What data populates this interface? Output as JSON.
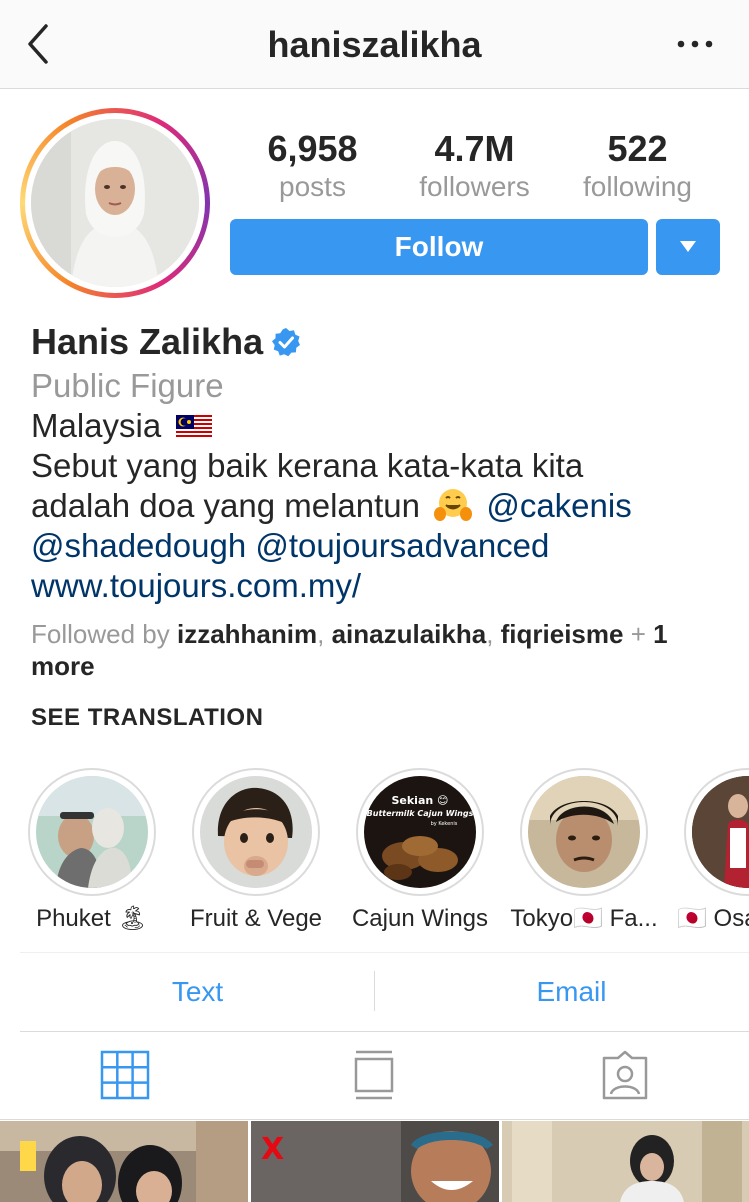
{
  "header": {
    "username": "haniszalikha"
  },
  "stats": [
    {
      "value": "6,958",
      "label": "posts"
    },
    {
      "value": "4.7M",
      "label": "followers"
    },
    {
      "value": "522",
      "label": "following"
    }
  ],
  "actions": {
    "follow_label": "Follow"
  },
  "bio": {
    "name": "Hanis Zalikha",
    "category": "Public Figure",
    "location": "Malaysia",
    "text_line1": "Sebut yang baik kerana kata-kata kita",
    "text_line2": "adalah doa yang melantun",
    "mention1": "@cakenis",
    "mention2": "@shadedough",
    "mention3": "@toujoursadvanced",
    "website": "www.toujours.com.my/"
  },
  "followed_by": {
    "prefix": "Followed by",
    "users": [
      "izzahhanim",
      "ainazulaikha",
      "fiqrieisme"
    ],
    "plus": "+",
    "more": "1 more"
  },
  "see_translation": "SEE TRANSLATION",
  "highlights": [
    {
      "label": "Phuket 🏝"
    },
    {
      "label": "Fruit & Vege"
    },
    {
      "label": "Cajun Wings",
      "cover_title": "Sekian 😊",
      "cover_sub": "Buttermilk Cajun Wings",
      "cover_by": "by Kekenis"
    },
    {
      "label": "Tokyo🇯🇵 Fa..."
    },
    {
      "label": "🇯🇵 Osa"
    }
  ],
  "contact": {
    "text_label": "Text",
    "email_label": "Email"
  },
  "tabs": [
    {
      "icon": "grid-icon",
      "active": true
    },
    {
      "icon": "feed-icon",
      "active": false
    },
    {
      "icon": "tagged-icon",
      "active": false
    }
  ],
  "colors": {
    "accent": "#3897f0",
    "link": "#003569",
    "muted": "#999999",
    "text": "#262626"
  }
}
